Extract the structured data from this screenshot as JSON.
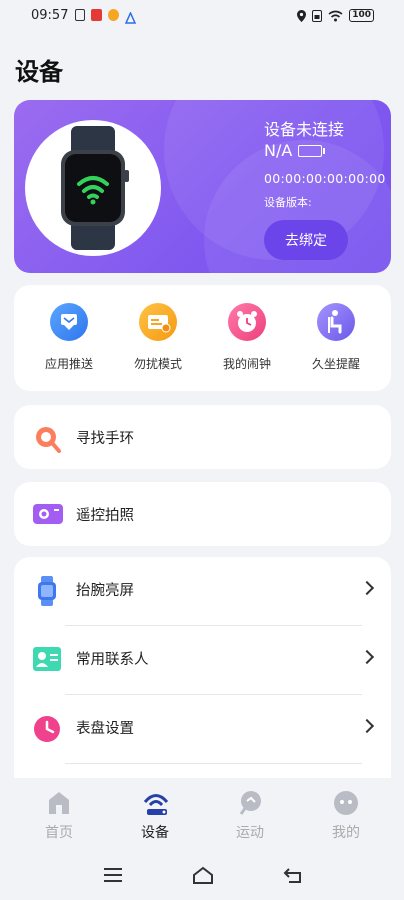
{
  "status_bar": {
    "time": "09:57",
    "battery": "100"
  },
  "page": {
    "title": "设备"
  },
  "device": {
    "connection_status": "设备未连接",
    "battery_text": "N/A",
    "mac": "00:00:00:00:00:00",
    "version_label": "设备版本:",
    "unbind_label": "去绑定"
  },
  "quick_actions": [
    {
      "label": "应用推送",
      "icon": "app-push-icon",
      "color": "#3d8ef5"
    },
    {
      "label": "勿扰模式",
      "icon": "do-not-disturb-icon",
      "color": "#f5a623"
    },
    {
      "label": "我的闹钟",
      "icon": "alarm-clock-icon",
      "color": "#f2558b"
    },
    {
      "label": "久坐提醒",
      "icon": "sedentary-reminder-icon",
      "color": "#7f6cf0"
    }
  ],
  "features": {
    "find_band": "寻找手环",
    "remote_camera": "遥控拍照"
  },
  "settings": [
    {
      "label": "抬腕亮屏",
      "icon": "wrist-raise-icon"
    },
    {
      "label": "常用联系人",
      "icon": "contacts-icon"
    },
    {
      "label": "表盘设置",
      "icon": "watch-face-icon"
    }
  ],
  "nav": [
    {
      "label": "首页",
      "icon": "home-icon"
    },
    {
      "label": "设备",
      "icon": "device-icon"
    },
    {
      "label": "运动",
      "icon": "sport-icon"
    },
    {
      "label": "我的",
      "icon": "profile-icon"
    }
  ],
  "active_nav": "设备",
  "colors": {
    "accent": "#8159f0",
    "active_nav": "#2540a8",
    "inactive_nav": "#aaaaaa"
  }
}
